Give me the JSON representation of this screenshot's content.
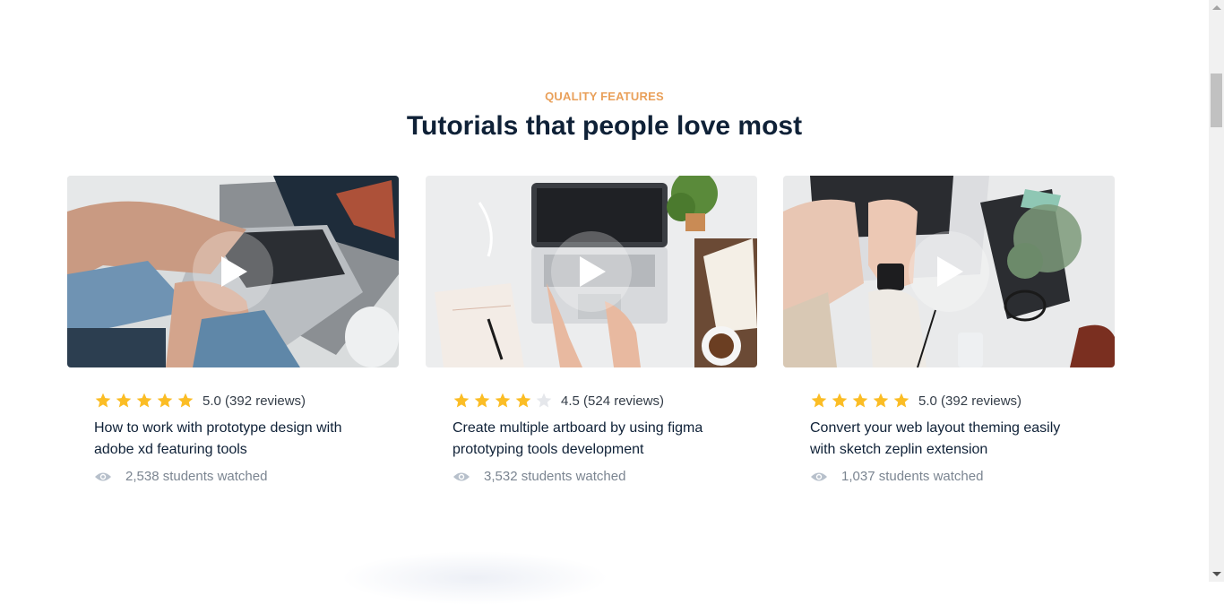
{
  "section": {
    "eyebrow": "QUALITY FEATURES",
    "title": "Tutorials that people love most"
  },
  "colors": {
    "accent": "#e9a05a",
    "heading": "#0f2137",
    "star": "#fbbd25",
    "star_empty": "#e5e7eb",
    "muted": "#7b8591"
  },
  "cards": [
    {
      "rating": 5,
      "rating_text": "5.0 (392 reviews)",
      "title": "How to work with prototype design with adobe xd featuring tools",
      "watched": "2,538 students watched",
      "icons": [
        "play-icon",
        "star-icon",
        "eye-icon"
      ]
    },
    {
      "rating": 4,
      "rating_text": "4.5 (524 reviews)",
      "title": "Create multiple artboard by using figma prototyping tools development",
      "watched": "3,532 students watched",
      "icons": [
        "play-icon",
        "star-icon",
        "eye-icon"
      ]
    },
    {
      "rating": 5,
      "rating_text": "5.0 (392 reviews)",
      "title": "Convert your web layout theming easily with sketch zeplin extension",
      "watched": "1,037 students watched",
      "icons": [
        "play-icon",
        "star-icon",
        "eye-icon"
      ]
    }
  ]
}
